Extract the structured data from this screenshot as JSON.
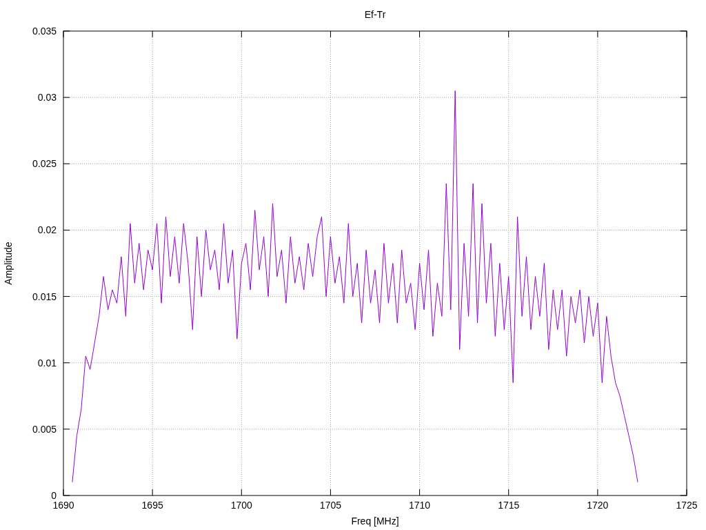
{
  "chart_data": {
    "type": "line",
    "title": "Ef-Tr",
    "xlabel": "Freq [MHz]",
    "ylabel": "Amplitude",
    "grid": true,
    "xlim": [
      1690,
      1725
    ],
    "ylim": [
      0,
      0.035
    ],
    "xticks": [
      1690,
      1695,
      1700,
      1705,
      1710,
      1715,
      1720,
      1725
    ],
    "yticks": [
      0,
      0.005,
      0.01,
      0.015,
      0.02,
      0.025,
      0.03,
      0.035
    ],
    "x": [
      1690.5,
      1690.75,
      1691,
      1691.25,
      1691.5,
      1691.75,
      1692,
      1692.25,
      1692.5,
      1692.75,
      1693,
      1693.25,
      1693.5,
      1693.75,
      1694,
      1694.25,
      1694.5,
      1694.75,
      1695,
      1695.25,
      1695.5,
      1695.75,
      1696,
      1696.25,
      1696.5,
      1696.75,
      1697,
      1697.25,
      1697.5,
      1697.75,
      1698,
      1698.25,
      1698.5,
      1698.75,
      1699,
      1699.25,
      1699.5,
      1699.75,
      1700,
      1700.25,
      1700.5,
      1700.75,
      1701,
      1701.25,
      1701.5,
      1701.75,
      1702,
      1702.25,
      1702.5,
      1702.75,
      1703,
      1703.25,
      1703.5,
      1703.75,
      1704,
      1704.25,
      1704.5,
      1704.75,
      1705,
      1705.25,
      1705.5,
      1705.75,
      1706,
      1706.25,
      1706.5,
      1706.75,
      1707,
      1707.25,
      1707.5,
      1707.75,
      1708,
      1708.25,
      1708.5,
      1708.75,
      1709,
      1709.25,
      1709.5,
      1709.75,
      1710,
      1710.25,
      1710.5,
      1710.75,
      1711,
      1711.25,
      1711.5,
      1711.75,
      1712,
      1712.25,
      1712.5,
      1712.75,
      1713,
      1713.25,
      1713.5,
      1713.75,
      1714,
      1714.25,
      1714.5,
      1714.75,
      1715,
      1715.25,
      1715.5,
      1715.75,
      1716,
      1716.25,
      1716.5,
      1716.75,
      1717,
      1717.25,
      1717.5,
      1717.75,
      1718,
      1718.25,
      1718.5,
      1718.75,
      1719,
      1719.25,
      1719.5,
      1719.75,
      1720,
      1720.25,
      1720.5,
      1720.75,
      1721,
      1721.25,
      1721.5,
      1721.75,
      1722,
      1722.25
    ],
    "series": [
      {
        "color": "#9400d3",
        "values": [
          0.001,
          0.0045,
          0.0065,
          0.0105,
          0.0095,
          0.0115,
          0.0135,
          0.0165,
          0.014,
          0.0155,
          0.0145,
          0.018,
          0.0135,
          0.0205,
          0.016,
          0.019,
          0.0155,
          0.0185,
          0.017,
          0.0205,
          0.0145,
          0.021,
          0.0165,
          0.0195,
          0.016,
          0.0205,
          0.0175,
          0.0125,
          0.0195,
          0.015,
          0.02,
          0.017,
          0.0185,
          0.0155,
          0.0205,
          0.016,
          0.0185,
          0.0118,
          0.0175,
          0.019,
          0.0155,
          0.0215,
          0.017,
          0.0195,
          0.015,
          0.022,
          0.0165,
          0.0185,
          0.0145,
          0.0195,
          0.016,
          0.018,
          0.0155,
          0.019,
          0.0165,
          0.0195,
          0.021,
          0.015,
          0.0195,
          0.016,
          0.018,
          0.0145,
          0.0205,
          0.015,
          0.0175,
          0.013,
          0.0185,
          0.0145,
          0.017,
          0.013,
          0.019,
          0.0145,
          0.0175,
          0.013,
          0.0185,
          0.0145,
          0.016,
          0.0125,
          0.0175,
          0.014,
          0.0185,
          0.012,
          0.016,
          0.0135,
          0.0235,
          0.014,
          0.0305,
          0.011,
          0.019,
          0.0135,
          0.0235,
          0.013,
          0.022,
          0.0145,
          0.019,
          0.012,
          0.0175,
          0.0125,
          0.0165,
          0.0085,
          0.021,
          0.0135,
          0.018,
          0.0125,
          0.0165,
          0.0135,
          0.0175,
          0.011,
          0.0155,
          0.0125,
          0.0155,
          0.0105,
          0.015,
          0.013,
          0.0155,
          0.0115,
          0.015,
          0.012,
          0.0145,
          0.0085,
          0.0135,
          0.0105,
          0.0085,
          0.0075,
          0.006,
          0.0045,
          0.003,
          0.001
        ]
      }
    ]
  }
}
